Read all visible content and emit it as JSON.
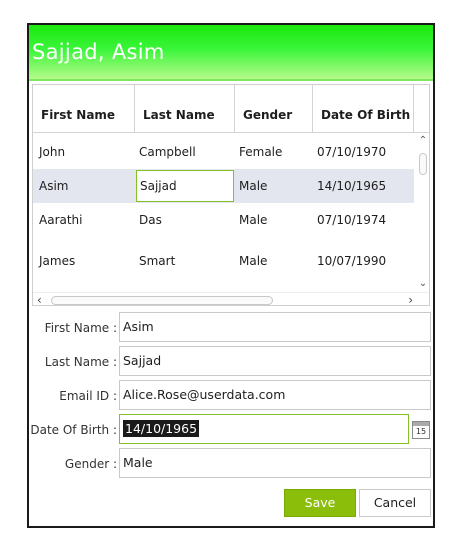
{
  "header": {
    "title": "Sajjad, Asim",
    "accent": "#1ce80d"
  },
  "grid": {
    "columns": [
      "First Name",
      "Last Name",
      "Gender",
      "Date Of Birth"
    ],
    "rows": [
      {
        "first": "John",
        "last": "Campbell",
        "gender": "Female",
        "dob": "07/10/1970"
      },
      {
        "first": "Asim",
        "last": "Sajjad",
        "gender": "Male",
        "dob": "14/10/1965"
      },
      {
        "first": "Aarathi",
        "last": "Das",
        "gender": "Male",
        "dob": "07/10/1974"
      },
      {
        "first": "James",
        "last": "Smart",
        "gender": "Male",
        "dob": "10/07/1990"
      }
    ],
    "selected_row": 1,
    "scroll_left_icon": "chevron-left-icon",
    "scroll_right_icon": "chevron-right-icon",
    "scroll_up_icon": "chevron-up-icon",
    "scroll_down_icon": "chevron-down-icon"
  },
  "form": {
    "first_name_label": "First Name :",
    "first_name_value": "Asim",
    "last_name_label": "Last Name :",
    "last_name_value": "Sajjad",
    "email_label": "Email ID :",
    "email_value": "Alice.Rose@userdata.com",
    "dob_label": "Date Of Birth :",
    "dob_value": "14/10/1965",
    "gender_label": "Gender :",
    "gender_value": "Male",
    "calendar_day": "15",
    "calendar_icon": "calendar-icon"
  },
  "actions": {
    "save_label": "Save",
    "cancel_label": "Cancel",
    "save_color": "#8bbe0a"
  }
}
